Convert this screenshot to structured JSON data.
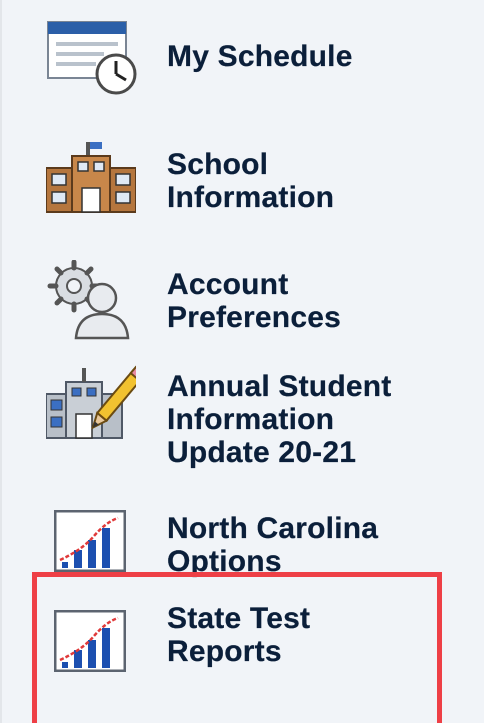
{
  "menu": {
    "items": [
      {
        "label_line1": "My Schedule",
        "label_line2": "",
        "label_line3": "",
        "icon": "schedule-calendar-clock-icon"
      },
      {
        "label_line1": "School",
        "label_line2": "Information",
        "label_line3": "",
        "icon": "school-building-icon"
      },
      {
        "label_line1": "Account",
        "label_line2": "Preferences",
        "label_line3": "",
        "icon": "account-gear-users-icon"
      },
      {
        "label_line1": "Annual Student",
        "label_line2": "Information",
        "label_line3": "Update 20-21",
        "icon": "school-pencil-icon"
      },
      {
        "label_line1": "North Carolina",
        "label_line2": "Options",
        "label_line3": "",
        "icon": "bar-chart-icon"
      },
      {
        "label_line1": "State Test",
        "label_line2": "Reports",
        "label_line3": "",
        "icon": "bar-chart-icon"
      }
    ],
    "highlighted_item": "State Test Reports"
  },
  "colors": {
    "panel_bg": "#f1f4f8",
    "label_text": "#0b1f3a",
    "highlight_border": "#ee3f46"
  }
}
